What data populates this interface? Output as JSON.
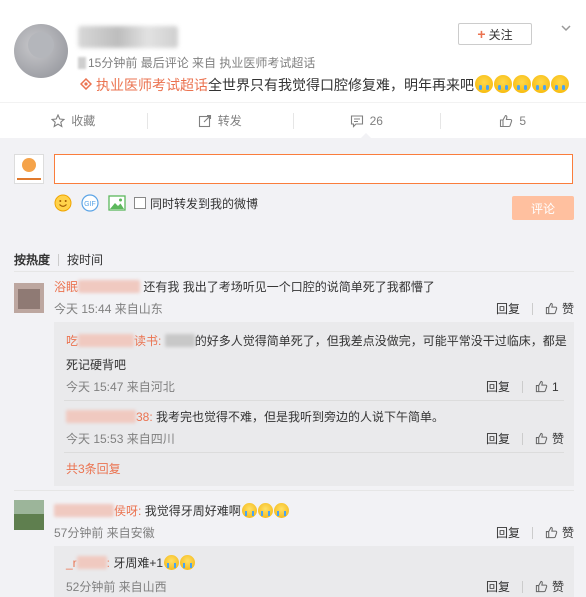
{
  "post": {
    "meta_time": "15分钟前",
    "meta_rest": "最后评论 来自 执业医师考试超话",
    "topic": "执业医师考试超话",
    "text": "全世界只有我觉得口腔修复难，明年再来吧",
    "follow_label": "关注"
  },
  "actions": {
    "favorite": "收藏",
    "forward": "转发",
    "comment_count": "26",
    "like_count": "5"
  },
  "composer": {
    "placeholder": "",
    "forward_label": "同时转发到我的微博",
    "submit_label": "评论"
  },
  "sort": {
    "hot": "按热度",
    "time": "按时间"
  },
  "comments": [
    {
      "name_prefix": "浴眠",
      "text": "还有我 我出了考场听见一个口腔的说简单死了我都懵了",
      "time": "今天 15:44 来自山东",
      "reply": "回复",
      "like": "赞",
      "replies": [
        {
          "name_prefix": "吃",
          "name_suffix": "读书:",
          "text": "的好多人觉得简单死了，但我差点没做完，可能平常没干过临床，都是",
          "text2": "死记硬背吧",
          "time": "今天 15:47 来自河北",
          "reply": "回复",
          "like": "1"
        },
        {
          "name_prefix": "",
          "name_suffix": "38:",
          "text": "我考完也觉得不难，但是我听到旁边的人说下午简单。",
          "time": "今天 15:53 来自四川",
          "reply": "回复",
          "like": "赞"
        }
      ],
      "more_replies": "共3条回复"
    },
    {
      "name_prefix": "",
      "name_suffix": "侯呀:",
      "text": "我觉得牙周好难啊",
      "time": "57分钟前 来自安徽",
      "reply": "回复",
      "like": "赞",
      "replies": [
        {
          "name_prefix": "_r",
          "name_suffix": ":",
          "text": "牙周难+1",
          "time": "52分钟前 来自山西",
          "reply": "回复",
          "like": "赞"
        }
      ]
    }
  ],
  "colors": {
    "accent": "#eb7350",
    "input_border": "#fa7d3c",
    "submit_bg": "#ffc09f",
    "comment_bg": "#f2f2f5"
  }
}
